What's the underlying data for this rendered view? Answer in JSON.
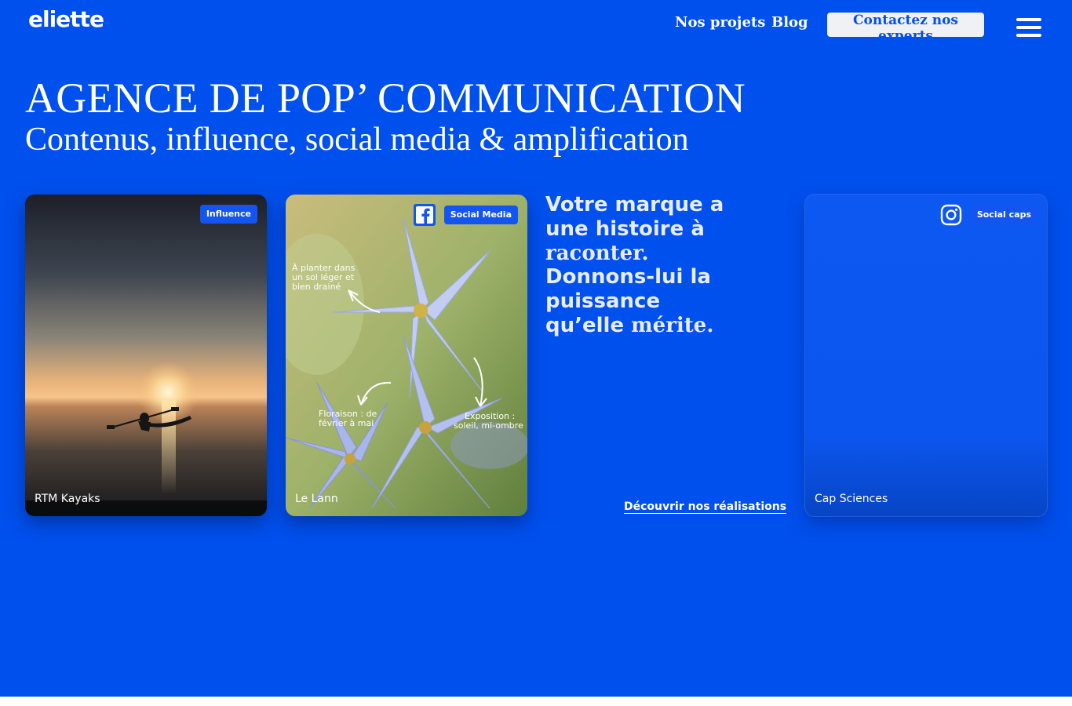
{
  "header": {
    "logo": "eliette",
    "nav": [
      "Nos projets",
      "Blog"
    ],
    "cta_label": "Contactez nos experts"
  },
  "hero": {
    "title": "AGENCE DE POP’ COMMUNICATION",
    "subtitle": "Contenus, influence, social media & amplification"
  },
  "cards": [
    {
      "badge": "Influence",
      "caption": "RTM Kayaks",
      "platform": ""
    },
    {
      "badge": "Social Media",
      "caption": "Le Lann",
      "platform": "facebook-icon",
      "overlay_texts": [
        "À planter dans",
        "un sol léger et",
        "bien drainé",
        "Floraison : de",
        "février à mai",
        "Exposition :",
        "soleil, mi-ombre"
      ]
    },
    {
      "badge": "Social caps",
      "caption": "Cap Sciences",
      "platform": "instagram-icon"
    }
  ],
  "tagline": {
    "l1": "Votre marque a",
    "l2a": "une histoire à",
    "l3": "raconter.",
    "l4": "Donnons-lui la",
    "l5": "puissance",
    "l6a": "qu’elle",
    "l6b": "mérite."
  },
  "discover_label": "Découvrir nos réalisations",
  "colors": {
    "background": "#0050ee",
    "cta_background": "#f0f1f5",
    "badge": "#1455f0"
  }
}
